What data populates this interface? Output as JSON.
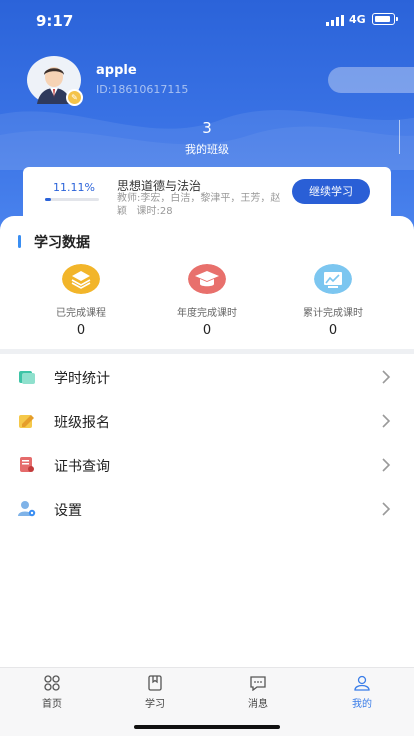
{
  "status_bar": {
    "time": "9:17",
    "network": "4G"
  },
  "profile": {
    "username": "apple",
    "user_id": "ID:18610617115",
    "avatar_icon": "avatar-icon",
    "badge_icon": "edit-badge-icon"
  },
  "my_class": {
    "count": "3",
    "label": "我的班级"
  },
  "course_card": {
    "progress_text": "11.11%",
    "progress_value": 0.1111,
    "title": "思想道德与法治",
    "teachers": "教师:李宏，白洁，黎津平，王芳，赵颖",
    "hours": "课时:28",
    "continue_label": "继续学习"
  },
  "study_data": {
    "title": "学习数据",
    "stats": [
      {
        "label": "已完成课程",
        "value": "0",
        "icon": "layers-icon",
        "color": "#f2b52a"
      },
      {
        "label": "年度完成课时",
        "value": "0",
        "icon": "graduation-cap-icon",
        "color": "#e8706c"
      },
      {
        "label": "累计完成课时",
        "value": "0",
        "icon": "chart-board-icon",
        "color": "#7cc6f0"
      }
    ]
  },
  "menu": [
    {
      "label": "学时统计",
      "icon": "hours-stats-icon"
    },
    {
      "label": "班级报名",
      "icon": "class-signup-icon"
    },
    {
      "label": "证书查询",
      "icon": "certificate-icon"
    },
    {
      "label": "设置",
      "icon": "settings-icon"
    }
  ],
  "tabs": [
    {
      "label": "首页",
      "icon": "home-icon"
    },
    {
      "label": "学习",
      "icon": "study-icon"
    },
    {
      "label": "消息",
      "icon": "message-icon"
    },
    {
      "label": "我的",
      "icon": "profile-icon",
      "active": true
    }
  ],
  "colors": {
    "primary": "#2b63d9",
    "accent": "#3a7de8"
  }
}
